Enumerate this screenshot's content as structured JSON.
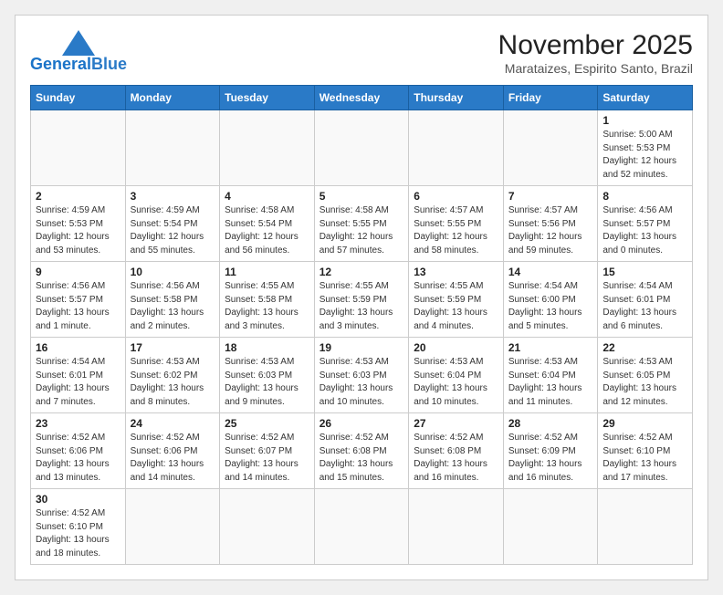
{
  "header": {
    "logo_general": "General",
    "logo_blue": "Blue",
    "month_title": "November 2025",
    "location": "Marataizes, Espirito Santo, Brazil"
  },
  "weekdays": [
    "Sunday",
    "Monday",
    "Tuesday",
    "Wednesday",
    "Thursday",
    "Friday",
    "Saturday"
  ],
  "weeks": [
    [
      {
        "day": "",
        "info": ""
      },
      {
        "day": "",
        "info": ""
      },
      {
        "day": "",
        "info": ""
      },
      {
        "day": "",
        "info": ""
      },
      {
        "day": "",
        "info": ""
      },
      {
        "day": "",
        "info": ""
      },
      {
        "day": "1",
        "info": "Sunrise: 5:00 AM\nSunset: 5:53 PM\nDaylight: 12 hours\nand 52 minutes."
      }
    ],
    [
      {
        "day": "2",
        "info": "Sunrise: 4:59 AM\nSunset: 5:53 PM\nDaylight: 12 hours\nand 53 minutes."
      },
      {
        "day": "3",
        "info": "Sunrise: 4:59 AM\nSunset: 5:54 PM\nDaylight: 12 hours\nand 55 minutes."
      },
      {
        "day": "4",
        "info": "Sunrise: 4:58 AM\nSunset: 5:54 PM\nDaylight: 12 hours\nand 56 minutes."
      },
      {
        "day": "5",
        "info": "Sunrise: 4:58 AM\nSunset: 5:55 PM\nDaylight: 12 hours\nand 57 minutes."
      },
      {
        "day": "6",
        "info": "Sunrise: 4:57 AM\nSunset: 5:55 PM\nDaylight: 12 hours\nand 58 minutes."
      },
      {
        "day": "7",
        "info": "Sunrise: 4:57 AM\nSunset: 5:56 PM\nDaylight: 12 hours\nand 59 minutes."
      },
      {
        "day": "8",
        "info": "Sunrise: 4:56 AM\nSunset: 5:57 PM\nDaylight: 13 hours\nand 0 minutes."
      }
    ],
    [
      {
        "day": "9",
        "info": "Sunrise: 4:56 AM\nSunset: 5:57 PM\nDaylight: 13 hours\nand 1 minute."
      },
      {
        "day": "10",
        "info": "Sunrise: 4:56 AM\nSunset: 5:58 PM\nDaylight: 13 hours\nand 2 minutes."
      },
      {
        "day": "11",
        "info": "Sunrise: 4:55 AM\nSunset: 5:58 PM\nDaylight: 13 hours\nand 3 minutes."
      },
      {
        "day": "12",
        "info": "Sunrise: 4:55 AM\nSunset: 5:59 PM\nDaylight: 13 hours\nand 3 minutes."
      },
      {
        "day": "13",
        "info": "Sunrise: 4:55 AM\nSunset: 5:59 PM\nDaylight: 13 hours\nand 4 minutes."
      },
      {
        "day": "14",
        "info": "Sunrise: 4:54 AM\nSunset: 6:00 PM\nDaylight: 13 hours\nand 5 minutes."
      },
      {
        "day": "15",
        "info": "Sunrise: 4:54 AM\nSunset: 6:01 PM\nDaylight: 13 hours\nand 6 minutes."
      }
    ],
    [
      {
        "day": "16",
        "info": "Sunrise: 4:54 AM\nSunset: 6:01 PM\nDaylight: 13 hours\nand 7 minutes."
      },
      {
        "day": "17",
        "info": "Sunrise: 4:53 AM\nSunset: 6:02 PM\nDaylight: 13 hours\nand 8 minutes."
      },
      {
        "day": "18",
        "info": "Sunrise: 4:53 AM\nSunset: 6:03 PM\nDaylight: 13 hours\nand 9 minutes."
      },
      {
        "day": "19",
        "info": "Sunrise: 4:53 AM\nSunset: 6:03 PM\nDaylight: 13 hours\nand 10 minutes."
      },
      {
        "day": "20",
        "info": "Sunrise: 4:53 AM\nSunset: 6:04 PM\nDaylight: 13 hours\nand 10 minutes."
      },
      {
        "day": "21",
        "info": "Sunrise: 4:53 AM\nSunset: 6:04 PM\nDaylight: 13 hours\nand 11 minutes."
      },
      {
        "day": "22",
        "info": "Sunrise: 4:53 AM\nSunset: 6:05 PM\nDaylight: 13 hours\nand 12 minutes."
      }
    ],
    [
      {
        "day": "23",
        "info": "Sunrise: 4:52 AM\nSunset: 6:06 PM\nDaylight: 13 hours\nand 13 minutes."
      },
      {
        "day": "24",
        "info": "Sunrise: 4:52 AM\nSunset: 6:06 PM\nDaylight: 13 hours\nand 14 minutes."
      },
      {
        "day": "25",
        "info": "Sunrise: 4:52 AM\nSunset: 6:07 PM\nDaylight: 13 hours\nand 14 minutes."
      },
      {
        "day": "26",
        "info": "Sunrise: 4:52 AM\nSunset: 6:08 PM\nDaylight: 13 hours\nand 15 minutes."
      },
      {
        "day": "27",
        "info": "Sunrise: 4:52 AM\nSunset: 6:08 PM\nDaylight: 13 hours\nand 16 minutes."
      },
      {
        "day": "28",
        "info": "Sunrise: 4:52 AM\nSunset: 6:09 PM\nDaylight: 13 hours\nand 16 minutes."
      },
      {
        "day": "29",
        "info": "Sunrise: 4:52 AM\nSunset: 6:10 PM\nDaylight: 13 hours\nand 17 minutes."
      }
    ],
    [
      {
        "day": "30",
        "info": "Sunrise: 4:52 AM\nSunset: 6:10 PM\nDaylight: 13 hours\nand 18 minutes."
      },
      {
        "day": "",
        "info": ""
      },
      {
        "day": "",
        "info": ""
      },
      {
        "day": "",
        "info": ""
      },
      {
        "day": "",
        "info": ""
      },
      {
        "day": "",
        "info": ""
      },
      {
        "day": "",
        "info": ""
      }
    ]
  ]
}
